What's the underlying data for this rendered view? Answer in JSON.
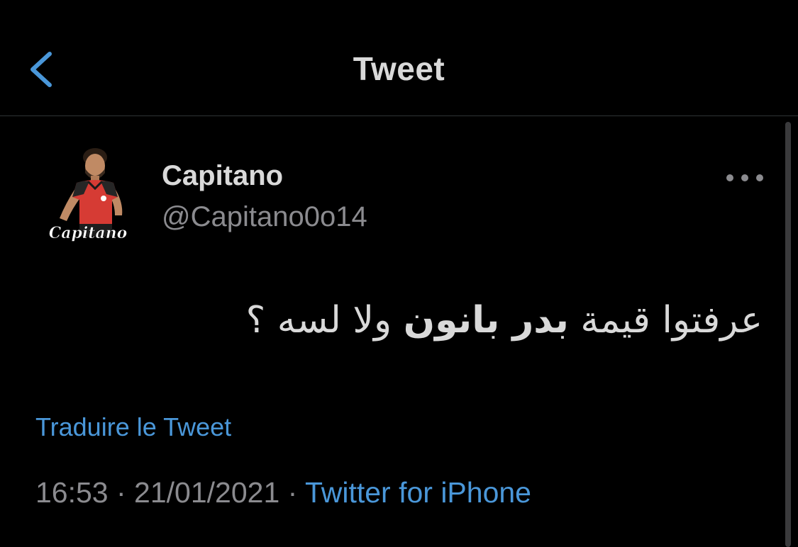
{
  "header": {
    "title": "Tweet",
    "back_icon": "chevron-left-icon"
  },
  "tweet": {
    "author_name": "Capitano",
    "author_handle": "@Capitano0o14",
    "avatar_caption": "Capitano",
    "more_icon": "ellipsis-icon",
    "text_part1": "عرفتوا قيمة ",
    "text_bold": "بدر بانون",
    "text_part2": " ولا لسه ؟",
    "translate_label": "Traduire le Tweet",
    "time": "16:53",
    "separator": " · ",
    "date": "21/01/2021",
    "source": "Twitter for iPhone"
  },
  "colors": {
    "background": "#000000",
    "text": "#d9d9d9",
    "muted": "#8b8b8f",
    "link": "#4a97d9",
    "divider": "#2f3336",
    "jersey": "#d63b34"
  }
}
